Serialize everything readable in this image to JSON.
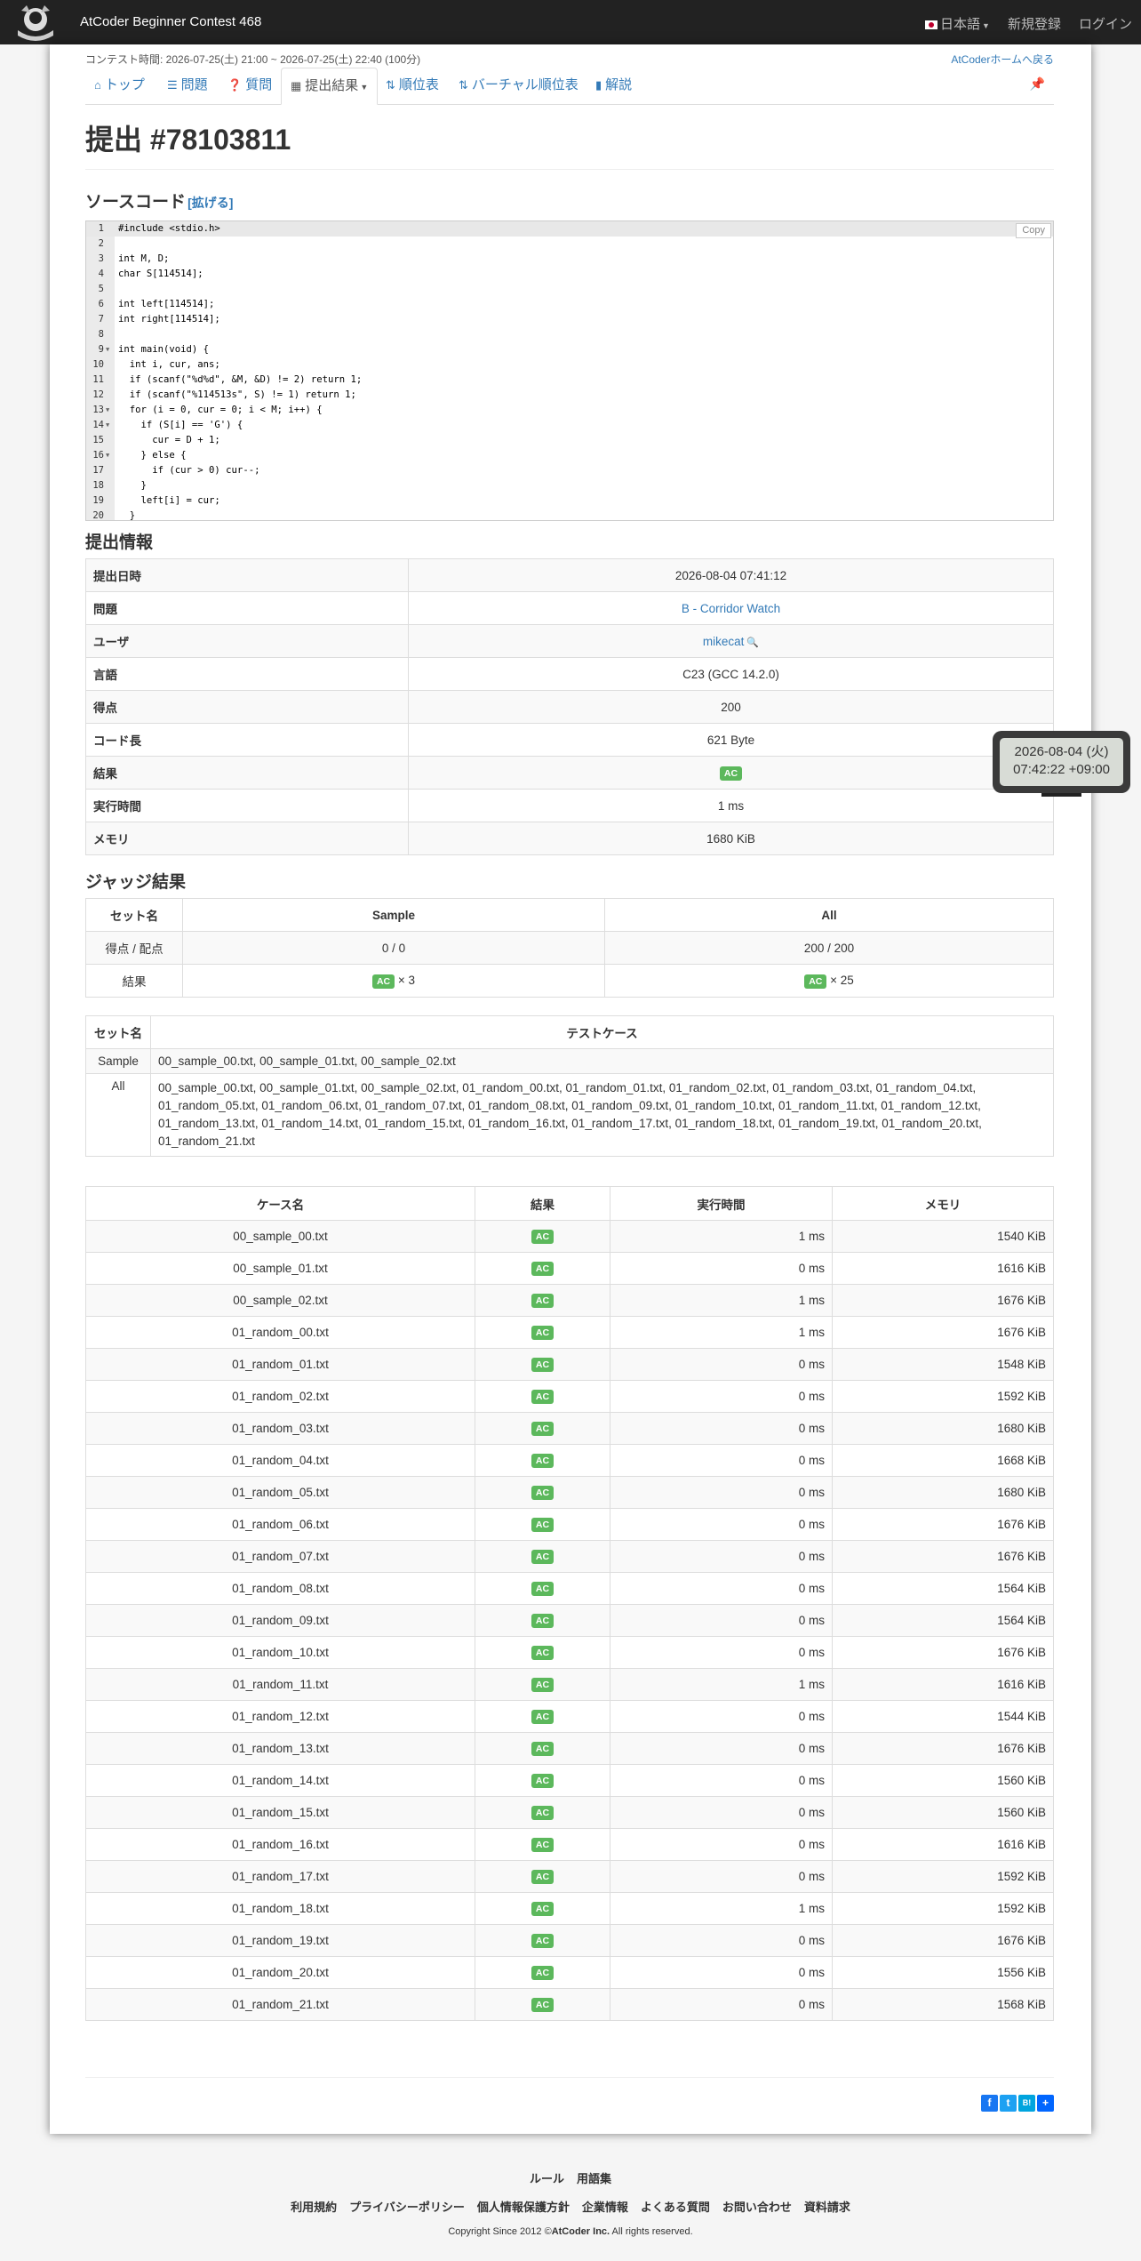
{
  "navbar": {
    "brand": "AtCoder Beginner Contest 468",
    "lang": "日本語",
    "signup": "新規登録",
    "login": "ログイン"
  },
  "header": {
    "contest_time": "コンテスト時間: 2026-07-25(土) 21:00 ~ 2026-07-25(土) 22:40 (100分)",
    "home_link": "AtCoderホームへ戻る"
  },
  "tabs": [
    {
      "label": "トップ",
      "icon": "home-icon"
    },
    {
      "label": "問題",
      "icon": "list-icon"
    },
    {
      "label": "質問",
      "icon": "question-icon"
    },
    {
      "label": "提出結果",
      "icon": "table-icon"
    },
    {
      "label": "順位表",
      "icon": "sort-icon"
    },
    {
      "label": "バーチャル順位表",
      "icon": "sort-icon"
    },
    {
      "label": "解説",
      "icon": "book-icon"
    }
  ],
  "title": "提出 #78103811",
  "source_heading": "ソースコード",
  "expand_label": "[拡げる]",
  "copy_label": "Copy",
  "code_lines": [
    "#include <stdio.h>",
    "",
    "int M, D;",
    "char S[114514];",
    "",
    "int left[114514];",
    "int right[114514];",
    "",
    "int main(void) {",
    "  int i, cur, ans;",
    "  if (scanf(\"%d%d\", &M, &D) != 2) return 1;",
    "  if (scanf(\"%114513s\", S) != 1) return 1;",
    "  for (i = 0, cur = 0; i < M; i++) {",
    "    if (S[i] == 'G') {",
    "      cur = D + 1;",
    "    } else {",
    "      if (cur > 0) cur--;",
    "    }",
    "    left[i] = cur;",
    "  }"
  ],
  "fold_lines": [
    9,
    13,
    14,
    16
  ],
  "info_heading": "提出情報",
  "info": [
    {
      "k": "提出日時",
      "v": "2026-08-04 07:41:12"
    },
    {
      "k": "問題",
      "v": "B - Corridor Watch"
    },
    {
      "k": "ユーザ",
      "v": "mikecat"
    },
    {
      "k": "言語",
      "v": "C23 (GCC 14.2.0)"
    },
    {
      "k": "得点",
      "v": "200"
    },
    {
      "k": "コード長",
      "v": "621 Byte"
    },
    {
      "k": "結果",
      "v": "AC"
    },
    {
      "k": "実行時間",
      "v": "1 ms"
    },
    {
      "k": "メモリ",
      "v": "1680 KiB"
    }
  ],
  "judge_heading": "ジャッジ結果",
  "judge": {
    "h_set": "セット名",
    "h_sample": "Sample",
    "h_all": "All",
    "score_label": "得点 / 配点",
    "score_sample": "0 / 0",
    "score_all": "200 / 200",
    "result_label": "結果",
    "ac": "AC",
    "count_sample": "× 3",
    "count_all": "× 25"
  },
  "sets": {
    "h_set": "セット名",
    "h_cases": "テストケース",
    "rows": [
      {
        "name": "Sample",
        "cases": "00_sample_00.txt, 00_sample_01.txt, 00_sample_02.txt"
      },
      {
        "name": "All",
        "cases": "00_sample_00.txt, 00_sample_01.txt, 00_sample_02.txt, 01_random_00.txt, 01_random_01.txt, 01_random_02.txt, 01_random_03.txt, 01_random_04.txt, 01_random_05.txt, 01_random_06.txt, 01_random_07.txt, 01_random_08.txt, 01_random_09.txt, 01_random_10.txt, 01_random_11.txt, 01_random_12.txt, 01_random_13.txt, 01_random_14.txt, 01_random_15.txt, 01_random_16.txt, 01_random_17.txt, 01_random_18.txt, 01_random_19.txt, 01_random_20.txt, 01_random_21.txt"
      }
    ]
  },
  "cases_headers": [
    "ケース名",
    "結果",
    "実行時間",
    "メモリ"
  ],
  "cases": [
    [
      "00_sample_00.txt",
      "AC",
      "1 ms",
      "1540 KiB"
    ],
    [
      "00_sample_01.txt",
      "AC",
      "0 ms",
      "1616 KiB"
    ],
    [
      "00_sample_02.txt",
      "AC",
      "1 ms",
      "1676 KiB"
    ],
    [
      "01_random_00.txt",
      "AC",
      "1 ms",
      "1676 KiB"
    ],
    [
      "01_random_01.txt",
      "AC",
      "0 ms",
      "1548 KiB"
    ],
    [
      "01_random_02.txt",
      "AC",
      "0 ms",
      "1592 KiB"
    ],
    [
      "01_random_03.txt",
      "AC",
      "0 ms",
      "1680 KiB"
    ],
    [
      "01_random_04.txt",
      "AC",
      "0 ms",
      "1668 KiB"
    ],
    [
      "01_random_05.txt",
      "AC",
      "0 ms",
      "1680 KiB"
    ],
    [
      "01_random_06.txt",
      "AC",
      "0 ms",
      "1676 KiB"
    ],
    [
      "01_random_07.txt",
      "AC",
      "0 ms",
      "1676 KiB"
    ],
    [
      "01_random_08.txt",
      "AC",
      "0 ms",
      "1564 KiB"
    ],
    [
      "01_random_09.txt",
      "AC",
      "0 ms",
      "1564 KiB"
    ],
    [
      "01_random_10.txt",
      "AC",
      "0 ms",
      "1676 KiB"
    ],
    [
      "01_random_11.txt",
      "AC",
      "1 ms",
      "1616 KiB"
    ],
    [
      "01_random_12.txt",
      "AC",
      "0 ms",
      "1544 KiB"
    ],
    [
      "01_random_13.txt",
      "AC",
      "0 ms",
      "1676 KiB"
    ],
    [
      "01_random_14.txt",
      "AC",
      "0 ms",
      "1560 KiB"
    ],
    [
      "01_random_15.txt",
      "AC",
      "0 ms",
      "1560 KiB"
    ],
    [
      "01_random_16.txt",
      "AC",
      "0 ms",
      "1616 KiB"
    ],
    [
      "01_random_17.txt",
      "AC",
      "0 ms",
      "1592 KiB"
    ],
    [
      "01_random_18.txt",
      "AC",
      "1 ms",
      "1592 KiB"
    ],
    [
      "01_random_19.txt",
      "AC",
      "0 ms",
      "1676 KiB"
    ],
    [
      "01_random_20.txt",
      "AC",
      "0 ms",
      "1556 KiB"
    ],
    [
      "01_random_21.txt",
      "AC",
      "0 ms",
      "1568 KiB"
    ]
  ],
  "footer": {
    "row1": [
      "ルール",
      "用語集"
    ],
    "row2": [
      "利用規約",
      "プライバシーポリシー",
      "個人情報保護方針",
      "企業情報",
      "よくある質問",
      "お問い合わせ",
      "資料請求"
    ],
    "copyright_prefix": "Copyright Since 2012 ©",
    "copyright_company": "AtCoder Inc.",
    "copyright_suffix": " All rights reserved."
  },
  "clock": {
    "date": "2026-08-04 (火)",
    "time": "07:42:22 +09:00"
  },
  "colors": {
    "ac": "#5cb85c",
    "link": "#337ab7",
    "navbar": "#222222"
  }
}
